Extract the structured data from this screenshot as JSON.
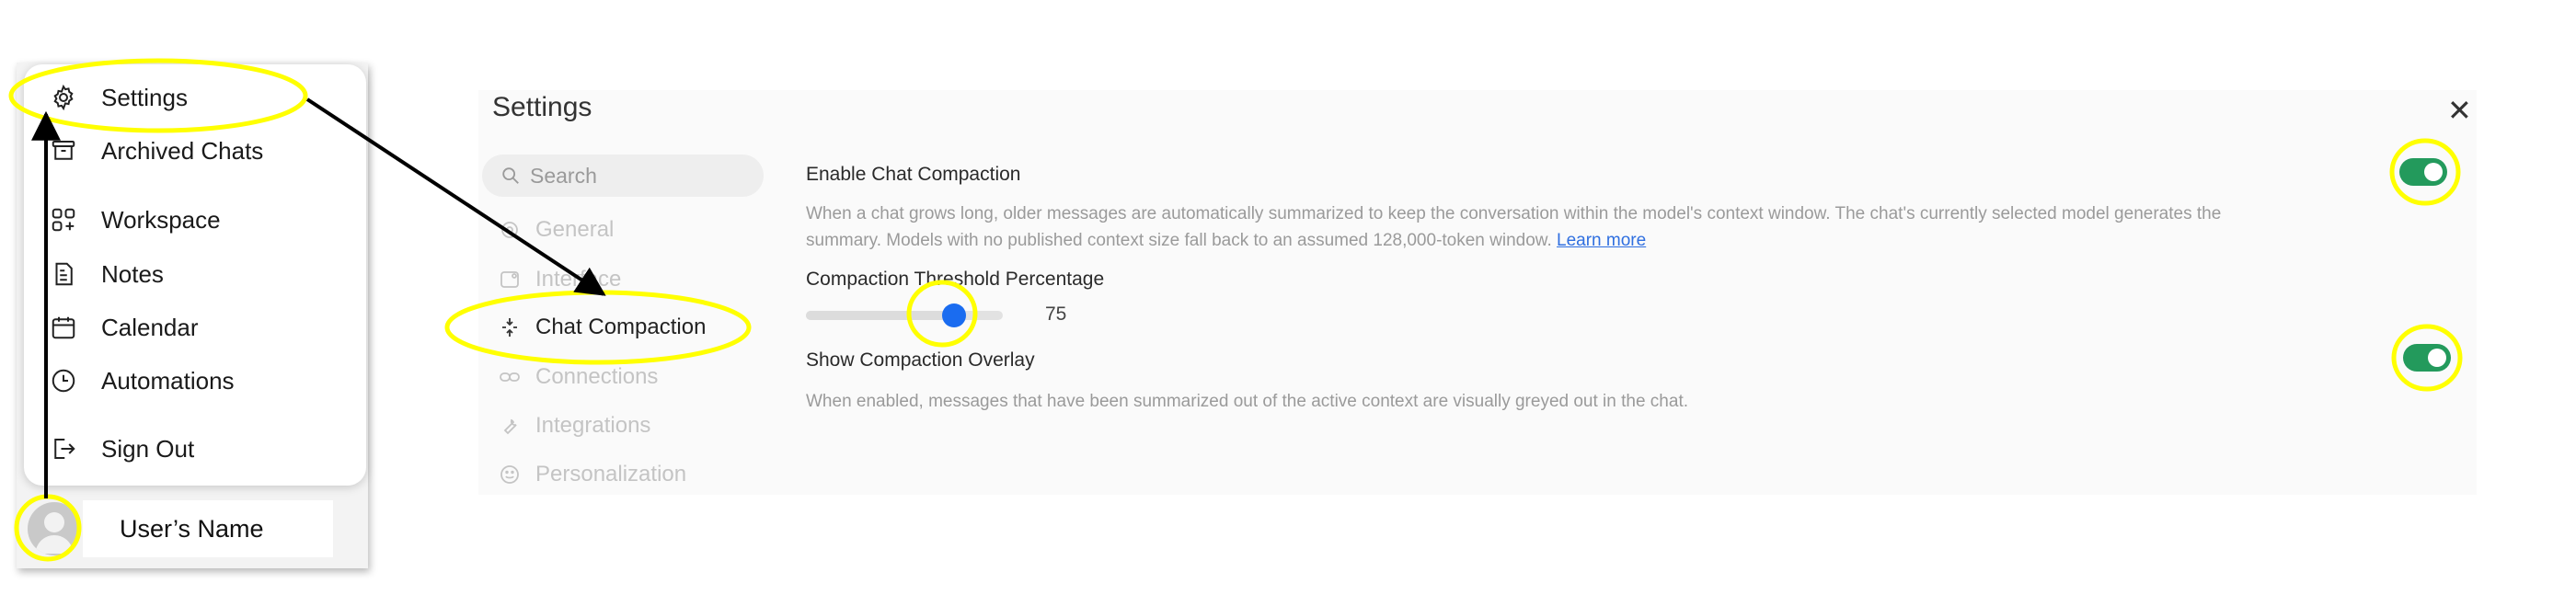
{
  "menu": {
    "items": [
      {
        "label": "Settings",
        "icon": "gear-icon"
      },
      {
        "label": "Archived Chats",
        "icon": "archive-icon"
      },
      {
        "label": "Workspace",
        "icon": "workspace-icon"
      },
      {
        "label": "Notes",
        "icon": "notes-icon"
      },
      {
        "label": "Calendar",
        "icon": "calendar-icon"
      },
      {
        "label": "Automations",
        "icon": "clock-icon"
      },
      {
        "label": "Sign Out",
        "icon": "sign-out-icon"
      }
    ],
    "user_name": "User’s Name"
  },
  "settings": {
    "title": "Settings",
    "search_placeholder": "Search",
    "nav": [
      {
        "label": "General",
        "icon": "gear-icon"
      },
      {
        "label": "Interface",
        "icon": "interface-icon"
      },
      {
        "label": "Chat Compaction",
        "icon": "compaction-icon",
        "active": true
      },
      {
        "label": "Connections",
        "icon": "link-icon"
      },
      {
        "label": "Integrations",
        "icon": "wrench-icon"
      },
      {
        "label": "Personalization",
        "icon": "smile-icon"
      }
    ],
    "enable_compaction": {
      "title": "Enable Chat Compaction",
      "desc_line1": "When a chat grows long, older messages are automatically summarized to keep the conversation within the model's context window. The chat's currently selected model generates the",
      "desc_line2": "summary. Models with no published context size fall back to an assumed 128,000-token window.",
      "link": "Learn more",
      "enabled": true
    },
    "threshold": {
      "title": "Compaction Threshold Percentage",
      "value": 75,
      "value_label": "75"
    },
    "overlay": {
      "title": "Show Compaction Overlay",
      "desc": "When enabled, messages that have been summarized out of the active context are visually greyed out in the chat.",
      "enabled": true
    }
  },
  "colors": {
    "highlight": "#ffff00",
    "toggle_on": "#239a5c",
    "slider_knob": "#1a6cf0",
    "link": "#2f6fe0"
  }
}
